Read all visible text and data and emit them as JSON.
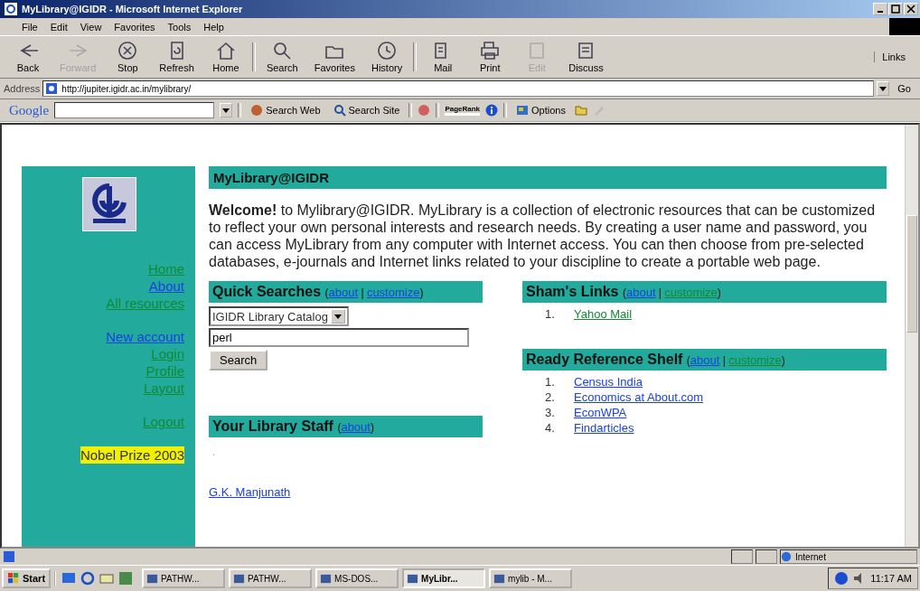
{
  "window": {
    "title": "MyLibrary@IGIDR - Microsoft Internet Explorer"
  },
  "menu": [
    "File",
    "Edit",
    "View",
    "Favorites",
    "Tools",
    "Help"
  ],
  "toolbar": [
    {
      "label": "Back",
      "disabled": false
    },
    {
      "label": "Forward",
      "disabled": true
    },
    {
      "label": "Stop",
      "disabled": false
    },
    {
      "label": "Refresh",
      "disabled": false
    },
    {
      "label": "Home",
      "disabled": false
    },
    {
      "label": "Search",
      "disabled": false
    },
    {
      "label": "Favorites",
      "disabled": false
    },
    {
      "label": "History",
      "disabled": false
    },
    {
      "label": "Mail",
      "disabled": false
    },
    {
      "label": "Print",
      "disabled": false
    },
    {
      "label": "Edit",
      "disabled": true
    },
    {
      "label": "Discuss",
      "disabled": false
    }
  ],
  "links_label": "Links",
  "address": {
    "label": "Address",
    "value": "http://jupiter.igidr.ac.in/mylibrary/",
    "go": "Go"
  },
  "google_bar": {
    "logo": "Google",
    "search_web": "Search Web",
    "search_site": "Search Site",
    "pagerank": "PageRank",
    "options": "Options"
  },
  "sidebar": {
    "groups": [
      [
        {
          "label": "Home",
          "visited": true
        },
        {
          "label": "About",
          "visited": false
        },
        {
          "label": "All resources",
          "visited": true
        }
      ],
      [
        {
          "label": "New account",
          "visited": false
        },
        {
          "label": "Login",
          "visited": true
        },
        {
          "label": "Profile",
          "visited": true
        },
        {
          "label": "Layout",
          "visited": true
        }
      ],
      [
        {
          "label": "Logout",
          "visited": true
        }
      ]
    ],
    "badge": "Nobel Prize 2003"
  },
  "heading": "MyLibrary@IGIDR",
  "welcome": "**Welcome!** to Mylibrary@IGIDR. MyLibrary is a collection of electronic resources that can be customized to reflect your own personal interests and research needs. By creating a user name and password, you can access MyLibrary from any computer with Internet access. You can then choose from pre-selected databases, e-journals and Internet links related to your discipline to create a portable web page.",
  "quick_searches": {
    "title": "Quick Searches",
    "punct": {
      "open": "(",
      "sep": "|",
      "close": ")"
    },
    "links": [
      {
        "label": "about",
        "visited": false
      },
      {
        "label": "customize",
        "visited": false
      }
    ],
    "select": "IGIDR Library Catalog",
    "query": "perl",
    "button": "Search"
  },
  "library_staff": {
    "title": "Your Library Staff",
    "punct": {
      "open": "(",
      "close": ")"
    },
    "links": [
      {
        "label": "about",
        "visited": false
      }
    ],
    "note": ".",
    "staff": [
      {
        "label": "G.K. Manjunath",
        "visited": false
      }
    ]
  },
  "shams_links": {
    "title": "Sham's Links",
    "punct": {
      "open": "(",
      "sep": "|",
      "close": ")"
    },
    "links": [
      {
        "label": "about",
        "visited": false
      },
      {
        "label": "customize",
        "visited": true
      }
    ],
    "items": [
      {
        "number": "1.",
        "label": "Yahoo Mail",
        "visited": true
      }
    ]
  },
  "ready_reference": {
    "title": "Ready Reference Shelf",
    "punct": {
      "open": "(",
      "sep": "|",
      "close": ")"
    },
    "links": [
      {
        "label": "about",
        "visited": false
      },
      {
        "label": "customize",
        "visited": true
      }
    ],
    "items": [
      {
        "number": "1.",
        "label": "Census India",
        "visited": false
      },
      {
        "number": "2.",
        "label": "Economics at About.com",
        "visited": false
      },
      {
        "number": "3.",
        "label": "EconWPA",
        "visited": false
      },
      {
        "number": "4.",
        "label": "Findarticles",
        "visited": false
      }
    ]
  },
  "status_bar": {
    "zone": "Internet"
  },
  "taskbar": {
    "start": "Start",
    "tasks": [
      {
        "label": "PATHW...",
        "selected": false
      },
      {
        "label": "PATHW...",
        "selected": false
      },
      {
        "label": "MS-DOS...",
        "selected": false
      },
      {
        "label": "MyLibr...",
        "selected": true
      },
      {
        "label": "mylib - M...",
        "selected": false
      }
    ],
    "clock": "11:17 AM"
  }
}
